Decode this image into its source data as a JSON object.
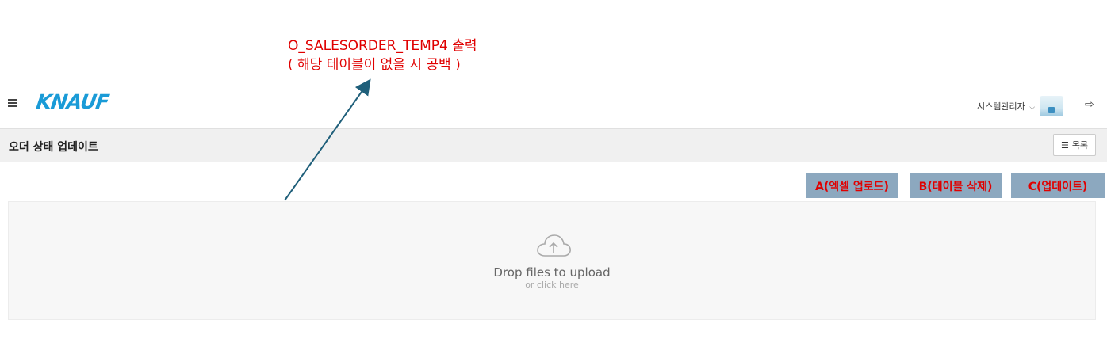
{
  "annotation": {
    "line1": "O_SALESORDER_TEMP4 출력",
    "line2": "( 해당 테이블이 없을 시 공백 )"
  },
  "header": {
    "logo": "KNAUF",
    "username": "시스템관리자"
  },
  "page": {
    "title": "오더 상태 업데이트",
    "list_button": "목록"
  },
  "actions": {
    "excel_upload": "A(엑셀 업로드)",
    "delete_table": "B(테이블 삭제)",
    "update": "C(업데이트)"
  },
  "dropzone": {
    "main": "Drop files to upload",
    "sub": "or click here"
  },
  "colors": {
    "annotation": "#e00000",
    "logo": "#1a9bd7",
    "action_bg": "#8ca8bf",
    "arrow": "#1f5f7a"
  },
  "icons": [
    "menu-icon",
    "chevron-down-icon",
    "logout-icon",
    "list-icon",
    "cloud-upload-icon"
  ]
}
